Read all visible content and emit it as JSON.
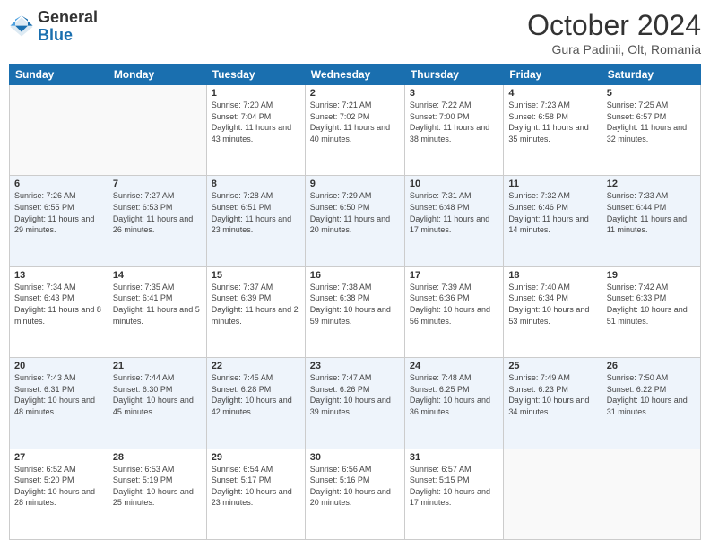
{
  "header": {
    "logo_general": "General",
    "logo_blue": "Blue",
    "month_title": "October 2024",
    "subtitle": "Gura Padinii, Olt, Romania"
  },
  "weekdays": [
    "Sunday",
    "Monday",
    "Tuesday",
    "Wednesday",
    "Thursday",
    "Friday",
    "Saturday"
  ],
  "weeks": [
    [
      {
        "day": "",
        "sunrise": "",
        "sunset": "",
        "daylight": ""
      },
      {
        "day": "",
        "sunrise": "",
        "sunset": "",
        "daylight": ""
      },
      {
        "day": "1",
        "sunrise": "Sunrise: 7:20 AM",
        "sunset": "Sunset: 7:04 PM",
        "daylight": "Daylight: 11 hours and 43 minutes."
      },
      {
        "day": "2",
        "sunrise": "Sunrise: 7:21 AM",
        "sunset": "Sunset: 7:02 PM",
        "daylight": "Daylight: 11 hours and 40 minutes."
      },
      {
        "day": "3",
        "sunrise": "Sunrise: 7:22 AM",
        "sunset": "Sunset: 7:00 PM",
        "daylight": "Daylight: 11 hours and 38 minutes."
      },
      {
        "day": "4",
        "sunrise": "Sunrise: 7:23 AM",
        "sunset": "Sunset: 6:58 PM",
        "daylight": "Daylight: 11 hours and 35 minutes."
      },
      {
        "day": "5",
        "sunrise": "Sunrise: 7:25 AM",
        "sunset": "Sunset: 6:57 PM",
        "daylight": "Daylight: 11 hours and 32 minutes."
      }
    ],
    [
      {
        "day": "6",
        "sunrise": "Sunrise: 7:26 AM",
        "sunset": "Sunset: 6:55 PM",
        "daylight": "Daylight: 11 hours and 29 minutes."
      },
      {
        "day": "7",
        "sunrise": "Sunrise: 7:27 AM",
        "sunset": "Sunset: 6:53 PM",
        "daylight": "Daylight: 11 hours and 26 minutes."
      },
      {
        "day": "8",
        "sunrise": "Sunrise: 7:28 AM",
        "sunset": "Sunset: 6:51 PM",
        "daylight": "Daylight: 11 hours and 23 minutes."
      },
      {
        "day": "9",
        "sunrise": "Sunrise: 7:29 AM",
        "sunset": "Sunset: 6:50 PM",
        "daylight": "Daylight: 11 hours and 20 minutes."
      },
      {
        "day": "10",
        "sunrise": "Sunrise: 7:31 AM",
        "sunset": "Sunset: 6:48 PM",
        "daylight": "Daylight: 11 hours and 17 minutes."
      },
      {
        "day": "11",
        "sunrise": "Sunrise: 7:32 AM",
        "sunset": "Sunset: 6:46 PM",
        "daylight": "Daylight: 11 hours and 14 minutes."
      },
      {
        "day": "12",
        "sunrise": "Sunrise: 7:33 AM",
        "sunset": "Sunset: 6:44 PM",
        "daylight": "Daylight: 11 hours and 11 minutes."
      }
    ],
    [
      {
        "day": "13",
        "sunrise": "Sunrise: 7:34 AM",
        "sunset": "Sunset: 6:43 PM",
        "daylight": "Daylight: 11 hours and 8 minutes."
      },
      {
        "day": "14",
        "sunrise": "Sunrise: 7:35 AM",
        "sunset": "Sunset: 6:41 PM",
        "daylight": "Daylight: 11 hours and 5 minutes."
      },
      {
        "day": "15",
        "sunrise": "Sunrise: 7:37 AM",
        "sunset": "Sunset: 6:39 PM",
        "daylight": "Daylight: 11 hours and 2 minutes."
      },
      {
        "day": "16",
        "sunrise": "Sunrise: 7:38 AM",
        "sunset": "Sunset: 6:38 PM",
        "daylight": "Daylight: 10 hours and 59 minutes."
      },
      {
        "day": "17",
        "sunrise": "Sunrise: 7:39 AM",
        "sunset": "Sunset: 6:36 PM",
        "daylight": "Daylight: 10 hours and 56 minutes."
      },
      {
        "day": "18",
        "sunrise": "Sunrise: 7:40 AM",
        "sunset": "Sunset: 6:34 PM",
        "daylight": "Daylight: 10 hours and 53 minutes."
      },
      {
        "day": "19",
        "sunrise": "Sunrise: 7:42 AM",
        "sunset": "Sunset: 6:33 PM",
        "daylight": "Daylight: 10 hours and 51 minutes."
      }
    ],
    [
      {
        "day": "20",
        "sunrise": "Sunrise: 7:43 AM",
        "sunset": "Sunset: 6:31 PM",
        "daylight": "Daylight: 10 hours and 48 minutes."
      },
      {
        "day": "21",
        "sunrise": "Sunrise: 7:44 AM",
        "sunset": "Sunset: 6:30 PM",
        "daylight": "Daylight: 10 hours and 45 minutes."
      },
      {
        "day": "22",
        "sunrise": "Sunrise: 7:45 AM",
        "sunset": "Sunset: 6:28 PM",
        "daylight": "Daylight: 10 hours and 42 minutes."
      },
      {
        "day": "23",
        "sunrise": "Sunrise: 7:47 AM",
        "sunset": "Sunset: 6:26 PM",
        "daylight": "Daylight: 10 hours and 39 minutes."
      },
      {
        "day": "24",
        "sunrise": "Sunrise: 7:48 AM",
        "sunset": "Sunset: 6:25 PM",
        "daylight": "Daylight: 10 hours and 36 minutes."
      },
      {
        "day": "25",
        "sunrise": "Sunrise: 7:49 AM",
        "sunset": "Sunset: 6:23 PM",
        "daylight": "Daylight: 10 hours and 34 minutes."
      },
      {
        "day": "26",
        "sunrise": "Sunrise: 7:50 AM",
        "sunset": "Sunset: 6:22 PM",
        "daylight": "Daylight: 10 hours and 31 minutes."
      }
    ],
    [
      {
        "day": "27",
        "sunrise": "Sunrise: 6:52 AM",
        "sunset": "Sunset: 5:20 PM",
        "daylight": "Daylight: 10 hours and 28 minutes."
      },
      {
        "day": "28",
        "sunrise": "Sunrise: 6:53 AM",
        "sunset": "Sunset: 5:19 PM",
        "daylight": "Daylight: 10 hours and 25 minutes."
      },
      {
        "day": "29",
        "sunrise": "Sunrise: 6:54 AM",
        "sunset": "Sunset: 5:17 PM",
        "daylight": "Daylight: 10 hours and 23 minutes."
      },
      {
        "day": "30",
        "sunrise": "Sunrise: 6:56 AM",
        "sunset": "Sunset: 5:16 PM",
        "daylight": "Daylight: 10 hours and 20 minutes."
      },
      {
        "day": "31",
        "sunrise": "Sunrise: 6:57 AM",
        "sunset": "Sunset: 5:15 PM",
        "daylight": "Daylight: 10 hours and 17 minutes."
      },
      {
        "day": "",
        "sunrise": "",
        "sunset": "",
        "daylight": ""
      },
      {
        "day": "",
        "sunrise": "",
        "sunset": "",
        "daylight": ""
      }
    ]
  ]
}
